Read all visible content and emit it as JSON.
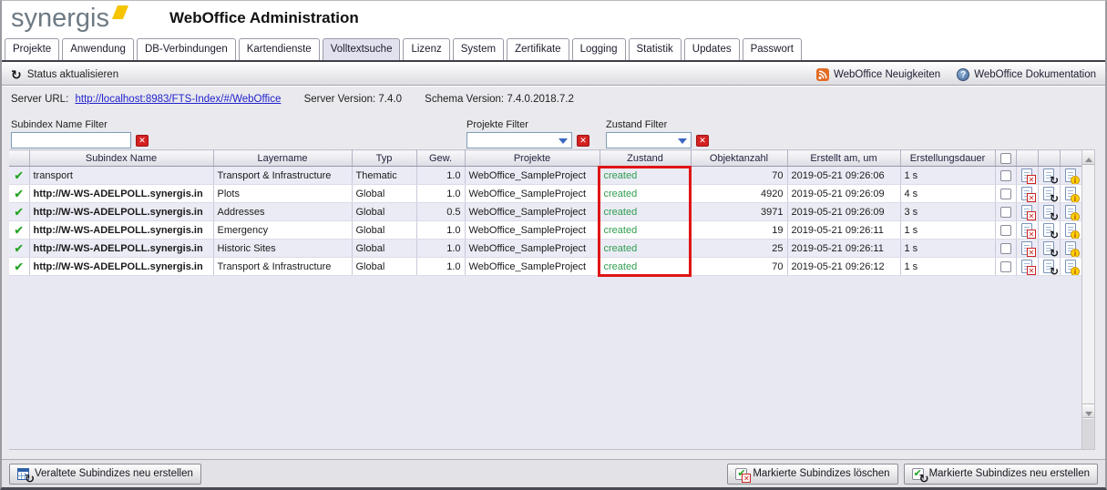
{
  "header": {
    "logo_text": "synergis",
    "title": "WebOffice Administration"
  },
  "tabs": [
    {
      "label": "Projekte",
      "active": false
    },
    {
      "label": "Anwendung",
      "active": false
    },
    {
      "label": "DB-Verbindungen",
      "active": false
    },
    {
      "label": "Kartendienste",
      "active": false
    },
    {
      "label": "Volltextsuche",
      "active": true
    },
    {
      "label": "Lizenz",
      "active": false
    },
    {
      "label": "System",
      "active": false
    },
    {
      "label": "Zertifikate",
      "active": false
    },
    {
      "label": "Logging",
      "active": false
    },
    {
      "label": "Statistik",
      "active": false
    },
    {
      "label": "Updates",
      "active": false
    },
    {
      "label": "Passwort",
      "active": false
    }
  ],
  "toolbar": {
    "refresh_label": "Status aktualisieren",
    "news_label": "WebOffice Neuigkeiten",
    "docs_label": "WebOffice Dokumentation"
  },
  "server_info": {
    "url_label": "Server URL:",
    "url": "http://localhost:8983/FTS-Index/#/WebOffice",
    "server_version_label": "Server Version:",
    "server_version": "7.4.0",
    "schema_version_label": "Schema Version:",
    "schema_version": "7.4.0.2018.7.2"
  },
  "filters": {
    "subindex_label": "Subindex Name Filter",
    "subindex_value": "",
    "projekte_label": "Projekte Filter",
    "projekte_value": "",
    "zustand_label": "Zustand Filter",
    "zustand_value": ""
  },
  "table": {
    "columns": [
      "Subindex Name",
      "Layername",
      "Typ",
      "Gew.",
      "Projekte",
      "Zustand",
      "Objektanzahl",
      "Erstellt am, um",
      "Erstellungsdauer"
    ],
    "rows": [
      {
        "subindex": "transport",
        "bold": false,
        "layername": "Transport & Infrastructure",
        "typ": "Thematic",
        "gew": "1.0",
        "projekte": "WebOffice_SampleProject",
        "zustand": "created",
        "objektanzahl": "70",
        "erstellt": "2019-05-21 09:26:06",
        "dauer": "1 s"
      },
      {
        "subindex": "http://W-WS-ADELPOLL.synergis.in",
        "bold": true,
        "layername": "Plots",
        "typ": "Global",
        "gew": "1.0",
        "projekte": "WebOffice_SampleProject",
        "zustand": "created",
        "objektanzahl": "4920",
        "erstellt": "2019-05-21 09:26:09",
        "dauer": "4 s"
      },
      {
        "subindex": "http://W-WS-ADELPOLL.synergis.in",
        "bold": true,
        "layername": "Addresses",
        "typ": "Global",
        "gew": "0.5",
        "projekte": "WebOffice_SampleProject",
        "zustand": "created",
        "objektanzahl": "3971",
        "erstellt": "2019-05-21 09:26:09",
        "dauer": "3 s"
      },
      {
        "subindex": "http://W-WS-ADELPOLL.synergis.in",
        "bold": true,
        "layername": "Emergency",
        "typ": "Global",
        "gew": "1.0",
        "projekte": "WebOffice_SampleProject",
        "zustand": "created",
        "objektanzahl": "19",
        "erstellt": "2019-05-21 09:26:11",
        "dauer": "1 s"
      },
      {
        "subindex": "http://W-WS-ADELPOLL.synergis.in",
        "bold": true,
        "layername": "Historic Sites",
        "typ": "Global",
        "gew": "1.0",
        "projekte": "WebOffice_SampleProject",
        "zustand": "created",
        "objektanzahl": "25",
        "erstellt": "2019-05-21 09:26:11",
        "dauer": "1 s"
      },
      {
        "subindex": "http://W-WS-ADELPOLL.synergis.in",
        "bold": true,
        "layername": "Transport & Infrastructure",
        "typ": "Global",
        "gew": "1.0",
        "projekte": "WebOffice_SampleProject",
        "zustand": "created",
        "objektanzahl": "70",
        "erstellt": "2019-05-21 09:26:12",
        "dauer": "1 s"
      }
    ]
  },
  "buttons": {
    "rebuild_outdated": "Veraltete Subindizes neu erstellen",
    "delete_marked": "Markierte Subindizes löschen",
    "rebuild_marked": "Markierte Subindizes neu erstellen"
  },
  "colors": {
    "accent_yellow": "#f6c400",
    "link_blue": "#2222cc",
    "created_green": "#2f9e4e",
    "highlight_red": "#e01515"
  },
  "annotation": {
    "type": "red-rectangle-highlight",
    "target": "zustand-column"
  }
}
